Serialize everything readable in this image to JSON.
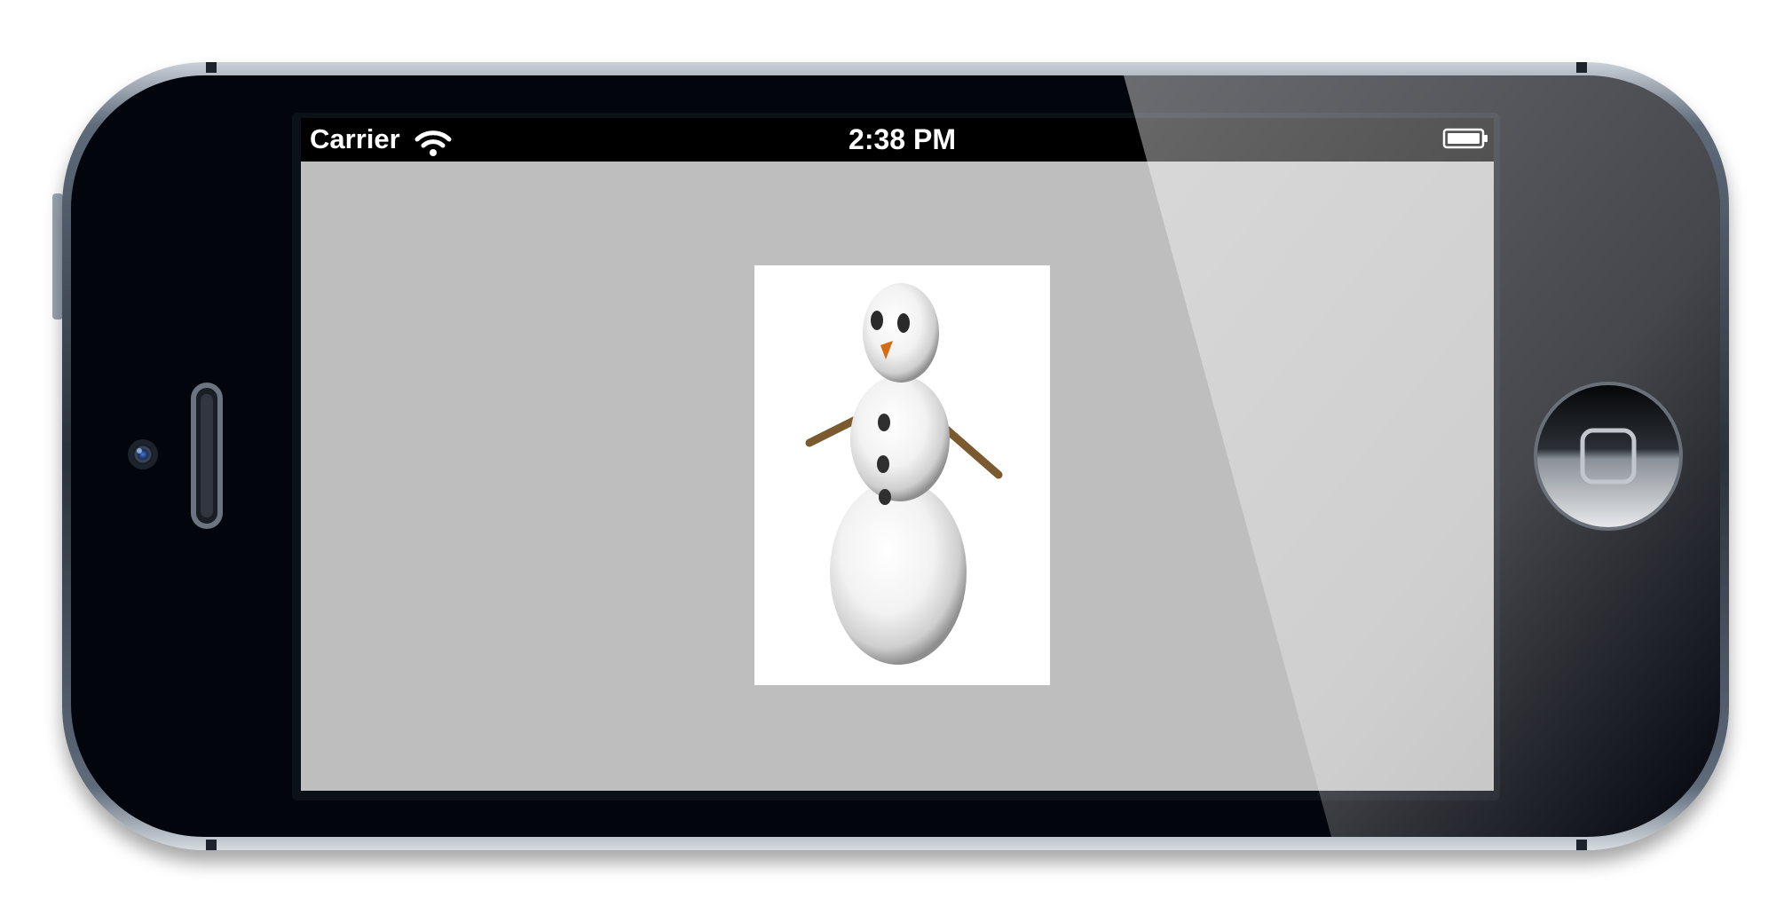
{
  "device": {
    "model": "iPhone",
    "orientation": "landscape",
    "frame_color": "#02050c",
    "bezel_color": "#8b98a8"
  },
  "status_bar": {
    "carrier": "Carrier",
    "time": "2:38 PM",
    "wifi_icon": "wifi-icon",
    "battery_icon": "battery-icon",
    "battery_level": 1.0,
    "background": "#000000"
  },
  "screen": {
    "background": "#bebebe",
    "image": {
      "subject": "snowman",
      "background": "#ffffff"
    }
  },
  "hardware": {
    "home_button_icon": "home-square-icon",
    "camera_icon": "front-camera-icon",
    "speaker_icon": "earpiece-speaker-icon",
    "volume_icon": "side-button-icon"
  }
}
